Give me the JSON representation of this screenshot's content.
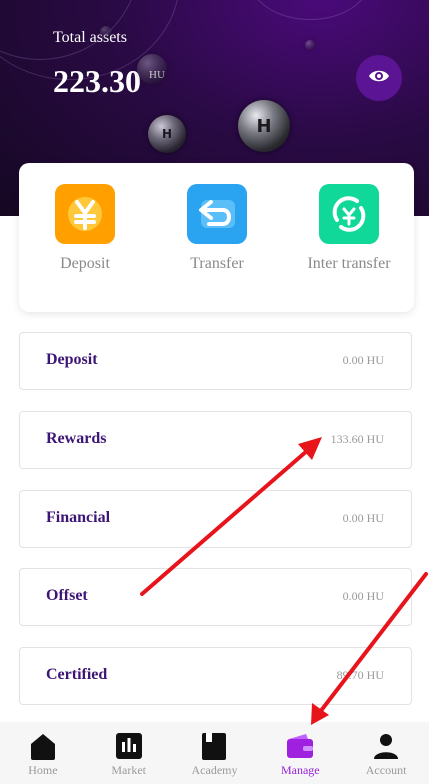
{
  "header": {
    "title": "Total assets",
    "amount": "223.30",
    "unit": "HU",
    "toggle_icon": "eye-icon",
    "coin_letter": "H"
  },
  "actions": [
    {
      "label": "Deposit",
      "icon": "yen-coin-icon",
      "color": "#ffa000"
    },
    {
      "label": "Transfer",
      "icon": "transfer-arrow-icon",
      "color": "#2aa4f0"
    },
    {
      "label": "Inter transfer",
      "icon": "exchange-yen-icon",
      "color": "#10d898"
    }
  ],
  "rows": [
    {
      "name": "Deposit",
      "value": "0.00 HU"
    },
    {
      "name": "Rewards",
      "value": "133.60 HU"
    },
    {
      "name": "Financial",
      "value": "0.00 HU"
    },
    {
      "name": "Offset",
      "value": "0.00 HU"
    },
    {
      "name": "Certified",
      "value": "89.70 HU"
    }
  ],
  "nav": [
    {
      "label": "Home",
      "icon": "home-icon",
      "active": false
    },
    {
      "label": "Market",
      "icon": "chart-icon",
      "active": false
    },
    {
      "label": "Academy",
      "icon": "book-icon",
      "active": false
    },
    {
      "label": "Manage",
      "icon": "wallet-icon",
      "active": true
    },
    {
      "label": "Account",
      "icon": "user-icon",
      "active": false
    }
  ],
  "colors": {
    "accent": "#9a22d8",
    "row_title": "#3d1575",
    "annotation_arrow": "#e8141c"
  }
}
